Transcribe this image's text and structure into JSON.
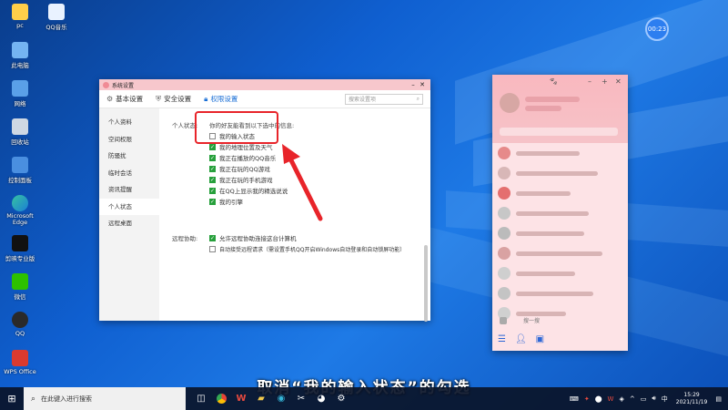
{
  "desktop": {
    "icons": [
      {
        "label": "pc"
      },
      {
        "label": "QQ音乐"
      },
      {
        "label": "此电脑"
      },
      {
        "label": "网络"
      },
      {
        "label": "回收站"
      },
      {
        "label": "控制面板"
      },
      {
        "label": "Microsoft Edge"
      },
      {
        "label": "剪映专业版"
      },
      {
        "label": "微信"
      },
      {
        "label": "QQ"
      },
      {
        "label": "WPS Office"
      }
    ],
    "clock_badge": "00:23"
  },
  "settings_window": {
    "title": "系统设置",
    "tabs": [
      {
        "label": "基本设置",
        "icon": "gear-icon"
      },
      {
        "label": "安全设置",
        "icon": "shield-icon"
      },
      {
        "label": "权限设置",
        "icon": "lock-icon"
      }
    ],
    "search_placeholder": "搜索设置项",
    "sidebar": [
      "个人资料",
      "空间权限",
      "防骚扰",
      "临时会话",
      "资讯提醒",
      "个人状态",
      "远程桌面"
    ],
    "section_status_label": "个人状态:",
    "section_status_intro": "你的好友能看到以下选中的信息:",
    "status_options": [
      {
        "label": "我的输入状态",
        "checked": false
      },
      {
        "label": "我的地理位置及天气",
        "checked": true
      },
      {
        "label": "我正在播放的QQ音乐",
        "checked": true
      },
      {
        "label": "我正在玩的QQ游戏",
        "checked": true
      },
      {
        "label": "我正在玩的手机游戏",
        "checked": true
      },
      {
        "label": "在QQ上显示我的精选说说",
        "checked": true
      },
      {
        "label": "我的引擎",
        "checked": true
      }
    ],
    "section_remote_label": "远程协助:",
    "remote_options": [
      {
        "label": "允许远程协助连接这台计算机",
        "checked": true
      },
      {
        "label": "自动接受远程请求（需设置手机QQ开启Windows自动登录和自动锁屏功能）",
        "checked": false
      }
    ]
  },
  "qq_window": {
    "footer_text": "搜一搜"
  },
  "subtitle": "取消“我的输入状态”的勾选",
  "taskbar": {
    "search_placeholder": "在此键入进行搜索",
    "time": "15:29",
    "date": "2021/11/19"
  },
  "colors": {
    "highlight": "#e8242a",
    "check": "#27a03c",
    "active_tab": "#1a6fd6"
  }
}
